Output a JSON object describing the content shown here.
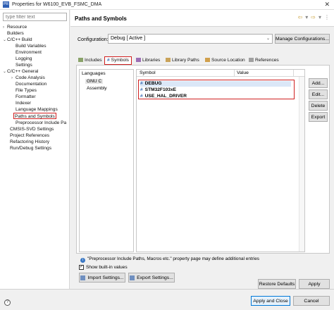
{
  "window": {
    "title": "Properties for W6100_EVB_FSMC_DMA",
    "app_icon_text": "PR",
    "close_glyph": "✕"
  },
  "left_tree": {
    "filter_placeholder": "type filter text",
    "items": [
      {
        "label": "Resource",
        "arrow": "›"
      },
      {
        "label": "Builders",
        "arrow": ""
      },
      {
        "label": "C/C++ Build",
        "arrow": "⌄"
      },
      {
        "label": "Build Variables",
        "arrow": ""
      },
      {
        "label": "Environment",
        "arrow": ""
      },
      {
        "label": "Logging",
        "arrow": ""
      },
      {
        "label": "Settings",
        "arrow": ""
      },
      {
        "label": "C/C++ General",
        "arrow": "⌄"
      },
      {
        "label": "Code Analysis",
        "arrow": "›"
      },
      {
        "label": "Documentation",
        "arrow": ""
      },
      {
        "label": "File Types",
        "arrow": ""
      },
      {
        "label": "Formatter",
        "arrow": ""
      },
      {
        "label": "Indexer",
        "arrow": ""
      },
      {
        "label": "Language Mappings",
        "arrow": ""
      },
      {
        "label": "Paths and Symbols",
        "arrow": ""
      },
      {
        "label": "Preprocessor Include Pa",
        "arrow": ""
      },
      {
        "label": "CMSIS-SVD Settings",
        "arrow": ""
      },
      {
        "label": "Project References",
        "arrow": ""
      },
      {
        "label": "Refactoring History",
        "arrow": ""
      },
      {
        "label": "Run/Debug Settings",
        "arrow": ""
      }
    ]
  },
  "header": {
    "page_title": "Paths and Symbols",
    "nav": {
      "back": "⇦",
      "back_menu": "▾",
      "forward": "⇨",
      "forward_menu": "▾",
      "menu": "⋮"
    }
  },
  "configuration": {
    "label": "Configuration:",
    "value": "Debug  [ Active ]",
    "dropdown_glyph": "⌄",
    "manage_button": "Manage Configurations..."
  },
  "tabs": [
    {
      "label": "Includes",
      "active": false
    },
    {
      "label": "Symbols",
      "active": true,
      "glyph": "#"
    },
    {
      "label": "Libraries",
      "active": false
    },
    {
      "label": "Library Paths",
      "active": false
    },
    {
      "label": "Source Location",
      "active": false
    },
    {
      "label": "References",
      "active": false
    }
  ],
  "languages": {
    "header": "Languages",
    "items": [
      "GNU C",
      "Assembly"
    ]
  },
  "symbols_table": {
    "columns": [
      "Symbol",
      "Value"
    ],
    "hash_glyph": "#",
    "rows": [
      {
        "symbol": "DEBUG",
        "value": ""
      },
      {
        "symbol": "STM32F103xE",
        "value": ""
      },
      {
        "symbol": "USE_HAL_DRIVER",
        "value": ""
      }
    ]
  },
  "side_buttons": {
    "add": "Add...",
    "edit": "Edit...",
    "delete": "Delete",
    "export": "Export"
  },
  "info": {
    "glyph": "i",
    "text": "\"Preprocessor Include Paths, Macros etc.\" property page may define additional entries"
  },
  "show_builtin": {
    "label": "Show built-in values",
    "checked": true,
    "check_glyph": "✓"
  },
  "import_button": "Import Settings...",
  "export_button": "Export Settings...",
  "restore_defaults": "Restore Defaults",
  "apply": "Apply",
  "apply_close": "Apply and Close",
  "cancel": "Cancel",
  "help_glyph": "?"
}
